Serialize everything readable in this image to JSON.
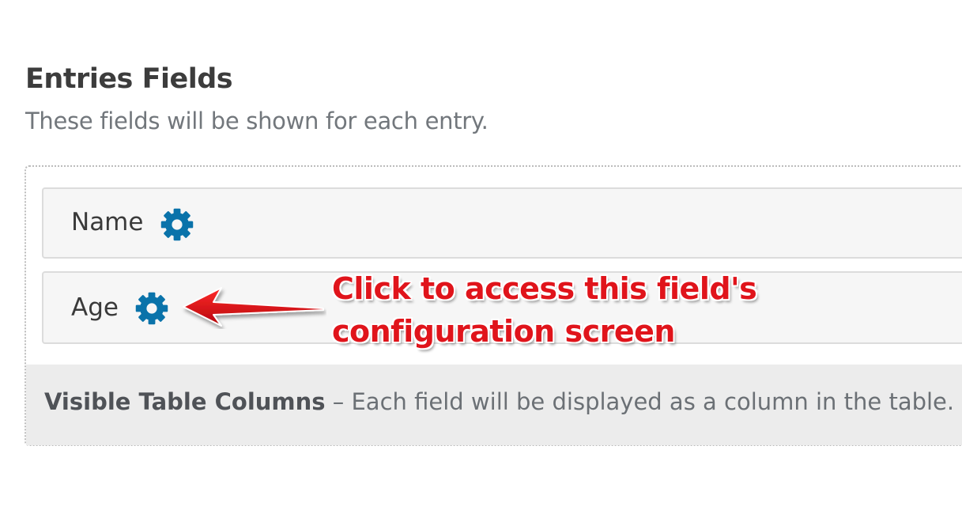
{
  "section": {
    "title": "Entries Fields",
    "description": "These fields will be shown for each entry."
  },
  "fields": [
    {
      "label": "Name",
      "settings_icon": "gear-icon"
    },
    {
      "label": "Age",
      "settings_icon": "gear-icon"
    }
  ],
  "footer": {
    "strong": "Visible Table Columns",
    "dash": " – ",
    "text": "Each field will be displayed as a column in the table."
  },
  "annotation": {
    "line1": "Click to access this field's",
    "line2": "configuration screen",
    "color": "#e0141b"
  },
  "colors": {
    "gear": "#0a73aa",
    "row_bg": "#f6f6f6",
    "footer_bg": "#ececec"
  }
}
